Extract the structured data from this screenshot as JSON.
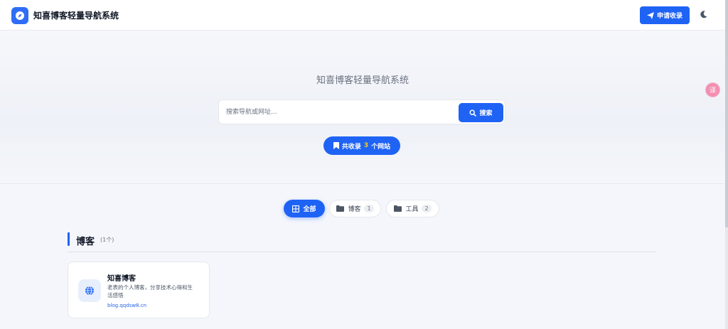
{
  "header": {
    "brand": "知喜博客轻量导航系统",
    "apply_label": "申请收录"
  },
  "hero": {
    "title": "知喜博客轻量导航系统",
    "search_placeholder": "搜索导航或网址...",
    "search_label": "搜索",
    "count_prefix": "共收录",
    "count_value": "3",
    "count_suffix": "个网站"
  },
  "float_button": {
    "label": "译"
  },
  "tabs": [
    {
      "label": "全部",
      "icon": "grid-icon",
      "active": true
    },
    {
      "label": "博客",
      "icon": "folder-icon",
      "count": "1"
    },
    {
      "label": "工具",
      "icon": "folder-icon",
      "count": "2"
    }
  ],
  "section": {
    "title": "博客",
    "count": "(1个)"
  },
  "cards": [
    {
      "title": "知喜博客",
      "desc": "老表的个人博客，分享技术心得和生活感悟",
      "url": "blog.qqdsw8.cn",
      "icon": "globe-icon"
    }
  ],
  "colors": {
    "accent": "#1f63f5",
    "highlight": "#facc15"
  }
}
